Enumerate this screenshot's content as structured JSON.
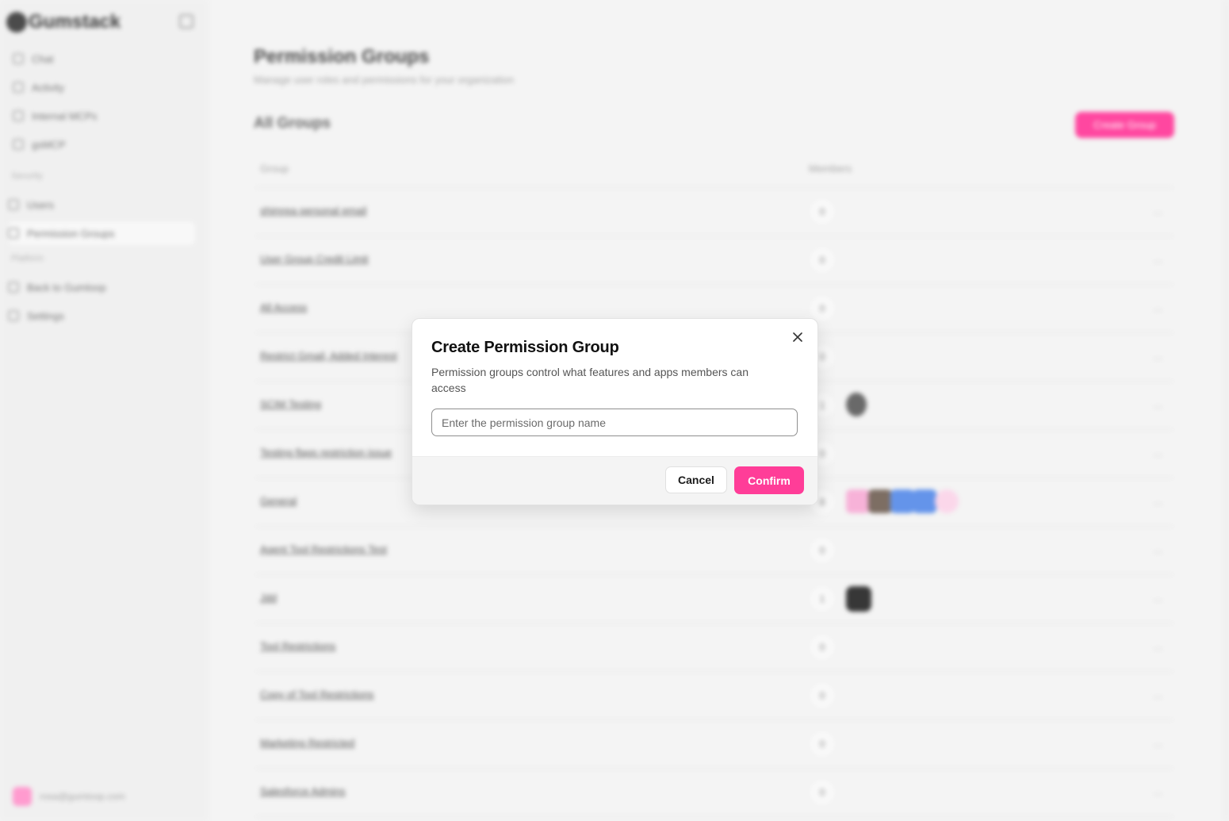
{
  "sidebar": {
    "brand": "Gumstack",
    "nav_items": [
      {
        "label": "Chat"
      },
      {
        "label": "Activity"
      },
      {
        "label": "Internal MCPs"
      },
      {
        "label": "gsMCP"
      }
    ],
    "section_security": "Security",
    "security_items": [
      {
        "label": "Users"
      },
      {
        "label": "Permission Groups"
      }
    ],
    "section_platform": "Platform",
    "platform_items": [
      {
        "label": "Back to Gumloop"
      },
      {
        "label": "Settings"
      }
    ],
    "user_email": "rosa@gumloop.com"
  },
  "main": {
    "title": "Permission Groups",
    "subtitle": "Manage user roles and permissions for your organization",
    "section_title": "All Groups",
    "create_button": "Create Group",
    "columns": {
      "group": "Group",
      "members": "Members"
    },
    "rows": [
      {
        "name": "shimrea personal email",
        "count": "0",
        "actions": "..."
      },
      {
        "name": "User Group Credit Limit",
        "count": "0",
        "actions": "..."
      },
      {
        "name": "All Access",
        "count": "0",
        "actions": "..."
      },
      {
        "name": "Restrict Gmail, Added Interest",
        "count": "0",
        "actions": "..."
      },
      {
        "name": "SCIM Testing",
        "count": "1",
        "actions": "..."
      },
      {
        "name": "Testing flags restriction issue",
        "count": "0",
        "actions": "..."
      },
      {
        "name": "General",
        "count": "8",
        "actions": "..."
      },
      {
        "name": "Agent Tool Restrictions Test",
        "count": "0",
        "actions": "..."
      },
      {
        "name": "Jdd",
        "count": "1",
        "actions": "..."
      },
      {
        "name": "Tool Restrictions",
        "count": "0",
        "actions": "..."
      },
      {
        "name": "Copy of Tool Restrictions",
        "count": "0",
        "actions": "..."
      },
      {
        "name": "Marketing Restricted",
        "count": "0",
        "actions": "..."
      },
      {
        "name": "Salesforce Admins",
        "count": "0",
        "actions": "..."
      }
    ]
  },
  "modal": {
    "title": "Create Permission Group",
    "description": "Permission groups control what features and apps members can access",
    "input_placeholder": "Enter the permission group name",
    "input_value": "",
    "cancel_label": "Cancel",
    "confirm_label": "Confirm",
    "close_icon": "close-icon"
  },
  "colors": {
    "accent": "#ff3d98",
    "background": "#f3f3f3",
    "modal_bg": "#ffffff"
  }
}
